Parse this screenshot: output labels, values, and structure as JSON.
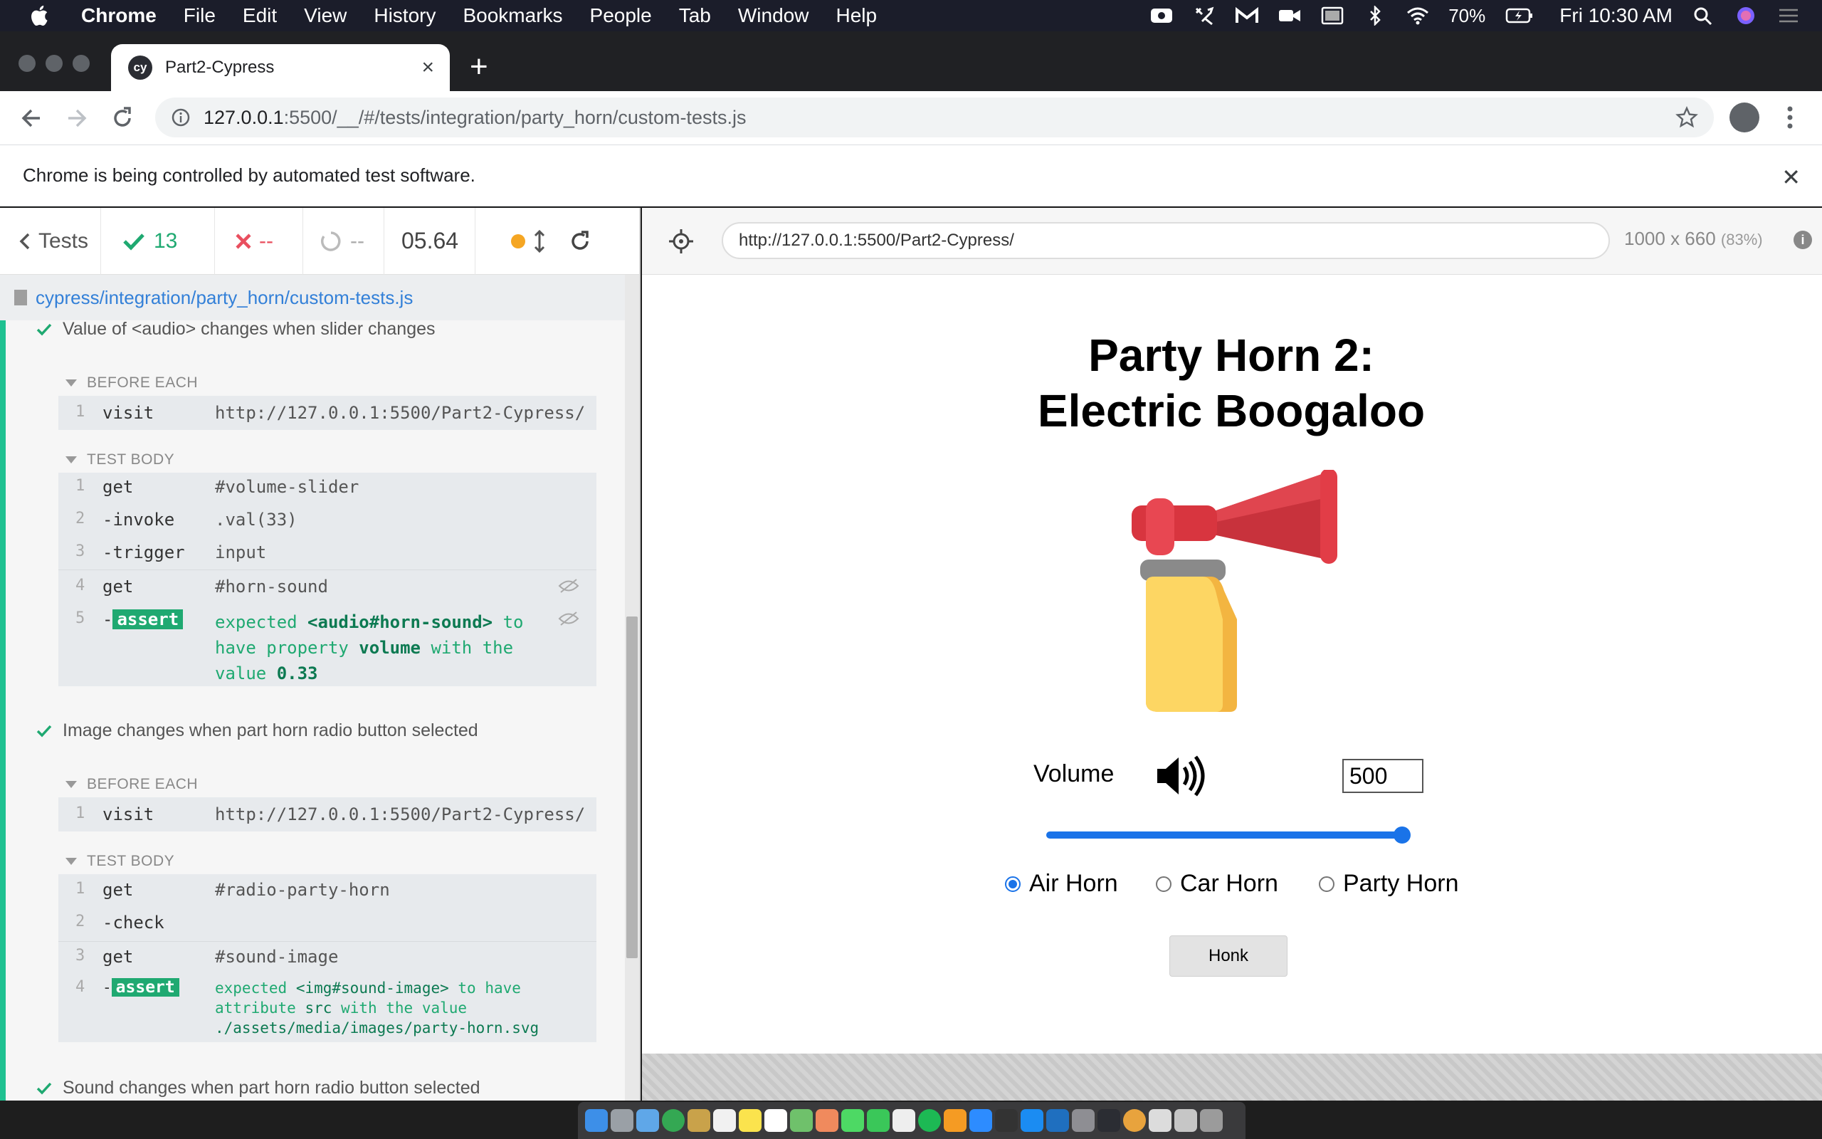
{
  "menubar": {
    "items": [
      "Chrome",
      "File",
      "Edit",
      "View",
      "History",
      "Bookmarks",
      "People",
      "Tab",
      "Window",
      "Help"
    ],
    "battery": "70%",
    "clock": "Fri 10:30 AM"
  },
  "browser": {
    "tab_title": "Part2-Cypress",
    "tab_favicon": "cy",
    "url_host": "127.0.0.1",
    "url_rest": ":5500/__/#/tests/integration/party_horn/custom-tests.js",
    "infobar_message": "Chrome is being controlled by automated test software."
  },
  "reporter": {
    "tests_label": "Tests",
    "passed": "13",
    "failed": "--",
    "pending": "--",
    "duration": "05.64",
    "spec_path": "cypress/integration/party_horn/custom-tests.js",
    "tests": [
      {
        "title": "Value of <audio> changes when slider changes",
        "before_each_label": "BEFORE EACH",
        "before_each": [
          {
            "num": "1",
            "name": "visit",
            "msg": "http://127.0.0.1:5500/Part2-Cypress/"
          }
        ],
        "body_label": "TEST BODY",
        "body": [
          {
            "num": "1",
            "name": "get",
            "msg": "#volume-slider"
          },
          {
            "num": "2",
            "name": "-invoke",
            "msg": ".val(33)"
          },
          {
            "num": "3",
            "name": "-trigger",
            "msg": "input"
          },
          {
            "num": "4",
            "name": "get",
            "msg": "#horn-sound"
          }
        ],
        "assert": {
          "num": "5",
          "dash": "-",
          "badge": "assert",
          "w1": "expected",
          "s1": "<audio#horn-sound>",
          "w2": "to have property",
          "s2": "volume",
          "w3": "with the value",
          "s3": "0.33"
        }
      },
      {
        "title": "Image changes when part horn radio button selected",
        "before_each_label": "BEFORE EACH",
        "before_each": [
          {
            "num": "1",
            "name": "visit",
            "msg": "http://127.0.0.1:5500/Part2-Cypress/"
          }
        ],
        "body_label": "TEST BODY",
        "body": [
          {
            "num": "1",
            "name": "get",
            "msg": "#radio-party-horn"
          },
          {
            "num": "2",
            "name": "-check",
            "msg": ""
          },
          {
            "num": "3",
            "name": "get",
            "msg": "#sound-image"
          }
        ],
        "assert": {
          "num": "4",
          "dash": "-",
          "badge": "assert",
          "w1": "expected",
          "s1": "<img#sound-image>",
          "w2": "to have attribute",
          "s2": "src",
          "w3": "with the value",
          "s3": "./assets/media/images/party-horn.svg"
        }
      },
      {
        "title": "Sound changes when part horn radio button selected"
      }
    ]
  },
  "aut": {
    "url": "http://127.0.0.1:5500/Part2-Cypress/",
    "size": "1000 x 660",
    "scale": "(83%)",
    "info_glyph": "i"
  },
  "app": {
    "title_line1": "Party Horn 2:",
    "title_line2": "Electric Boogaloo",
    "volume_label": "Volume",
    "volume_value": "500",
    "slider_level": 1.0,
    "radios": [
      {
        "label": "Air Horn",
        "checked": true
      },
      {
        "label": "Car Horn",
        "checked": false
      },
      {
        "label": "Party Horn",
        "checked": false
      }
    ],
    "honk_label": "Honk"
  },
  "colors": {
    "pass": "#1fa971",
    "fail": "#e94f5f",
    "accent": "#1a73e8",
    "link": "#3380d8"
  }
}
